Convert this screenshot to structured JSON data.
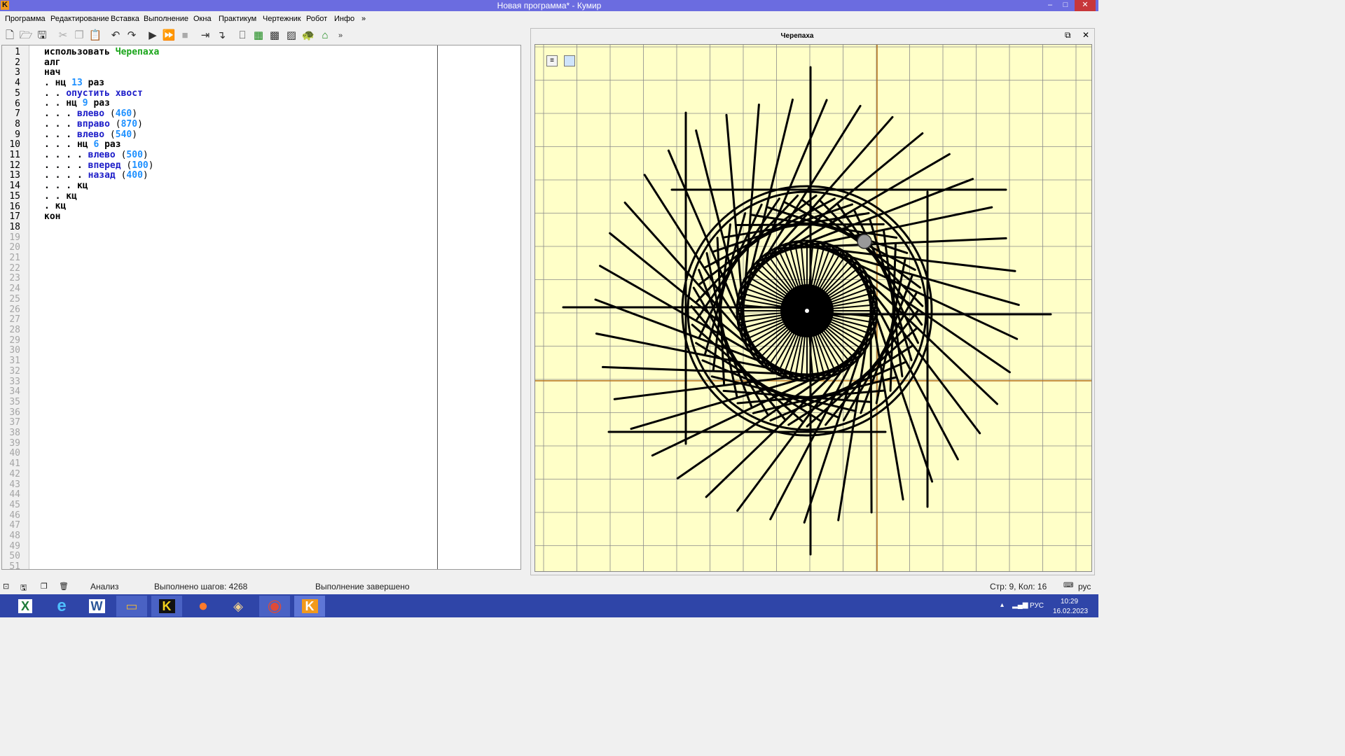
{
  "window": {
    "app_icon_letter": "K",
    "title": "Новая программа* - Кумир",
    "controls": [
      "–",
      "□",
      "✕"
    ]
  },
  "menu": [
    "Программа",
    "Редактирование",
    "Вставка",
    "Выполнение",
    "Окна",
    "Практикум",
    "Чертежник",
    "Робот",
    "Инфо",
    "»"
  ],
  "toolbar_overflow": "»",
  "editor": {
    "line_count": 51,
    "active_lines": 18,
    "lines": [
      [
        {
          "t": "использовать ",
          "c": "kw"
        },
        {
          "t": "Черепаха",
          "c": "lib"
        }
      ],
      [
        {
          "t": "алг",
          "c": "kw"
        }
      ],
      [
        {
          "t": "нач",
          "c": "kw"
        }
      ],
      [
        {
          "t": ". нц ",
          "c": "kw"
        },
        {
          "t": "13",
          "c": "num"
        },
        {
          "t": " раз",
          "c": "kw"
        }
      ],
      [
        {
          "t": ". . ",
          "c": "kw"
        },
        {
          "t": "опустить хвост",
          "c": "fn"
        }
      ],
      [
        {
          "t": ". . нц ",
          "c": "kw"
        },
        {
          "t": "9",
          "c": "num"
        },
        {
          "t": " раз",
          "c": "kw"
        }
      ],
      [
        {
          "t": ". . . ",
          "c": "kw"
        },
        {
          "t": "влево",
          "c": "fn"
        },
        {
          "t": " (",
          "c": "paren"
        },
        {
          "t": "460",
          "c": "num"
        },
        {
          "t": ")",
          "c": "paren"
        }
      ],
      [
        {
          "t": ". . . ",
          "c": "kw"
        },
        {
          "t": "вправо",
          "c": "fn"
        },
        {
          "t": " (",
          "c": "paren"
        },
        {
          "t": "870",
          "c": "num"
        },
        {
          "t": ")",
          "c": "paren"
        }
      ],
      [
        {
          "t": ". . . ",
          "c": "kw"
        },
        {
          "t": "влево",
          "c": "fn"
        },
        {
          "t": " (",
          "c": "paren"
        },
        {
          "t": "540",
          "c": "num"
        },
        {
          "t": ")",
          "c": "paren"
        }
      ],
      [
        {
          "t": ". . . нц ",
          "c": "kw"
        },
        {
          "t": "6",
          "c": "num"
        },
        {
          "t": " раз",
          "c": "kw"
        }
      ],
      [
        {
          "t": ". . . . ",
          "c": "kw"
        },
        {
          "t": "влево",
          "c": "fn"
        },
        {
          "t": " (",
          "c": "paren"
        },
        {
          "t": "500",
          "c": "num"
        },
        {
          "t": ")",
          "c": "paren"
        }
      ],
      [
        {
          "t": ". . . . ",
          "c": "kw"
        },
        {
          "t": "вперед",
          "c": "fn"
        },
        {
          "t": " (",
          "c": "paren"
        },
        {
          "t": "100",
          "c": "num"
        },
        {
          "t": ")",
          "c": "paren"
        }
      ],
      [
        {
          "t": ". . . . ",
          "c": "kw"
        },
        {
          "t": "назад",
          "c": "fn"
        },
        {
          "t": " (",
          "c": "paren"
        },
        {
          "t": "400",
          "c": "num"
        },
        {
          "t": ")",
          "c": "paren"
        }
      ],
      [
        {
          "t": ". . . кц",
          "c": "kw"
        }
      ],
      [
        {
          "t": ". . кц",
          "c": "kw"
        }
      ],
      [
        {
          "t": ". кц",
          "c": "kw"
        }
      ],
      [
        {
          "t": "кон",
          "c": "kw"
        }
      ],
      []
    ]
  },
  "turtle_panel": {
    "title": "Черепаха",
    "undock_icon": "⧉",
    "close_icon": "✕",
    "menu_btn": "≡"
  },
  "status": {
    "analysis": "Анализ",
    "steps": "Выполнено шагов: 4268",
    "state": "Выполнение завершено",
    "position": "Стр: 9, Кол: 16",
    "lang": "рус"
  },
  "taskbar": {
    "apps": [
      {
        "name": "excel",
        "glyph": "X",
        "color": "#1d7a3a"
      },
      {
        "name": "ie",
        "glyph": "e",
        "color": "#1ea1e8"
      },
      {
        "name": "word",
        "glyph": "W",
        "color": "#2a5699"
      },
      {
        "name": "explorer",
        "glyph": "▭",
        "color": "#e5b33a"
      },
      {
        "name": "kumir",
        "glyph": "K",
        "color": "#f2d21c"
      },
      {
        "name": "firefox",
        "glyph": "●",
        "color": "#ff7a2b"
      },
      {
        "name": "app7",
        "glyph": "◈",
        "color": "#e8e8e8"
      },
      {
        "name": "chrome",
        "glyph": "◉",
        "color": "#dd4b39"
      },
      {
        "name": "kumir-active",
        "glyph": "K",
        "color": "#f29a1c"
      }
    ],
    "tray_lang": "РУС",
    "time": "10:29",
    "date": "16.02.2023"
  }
}
